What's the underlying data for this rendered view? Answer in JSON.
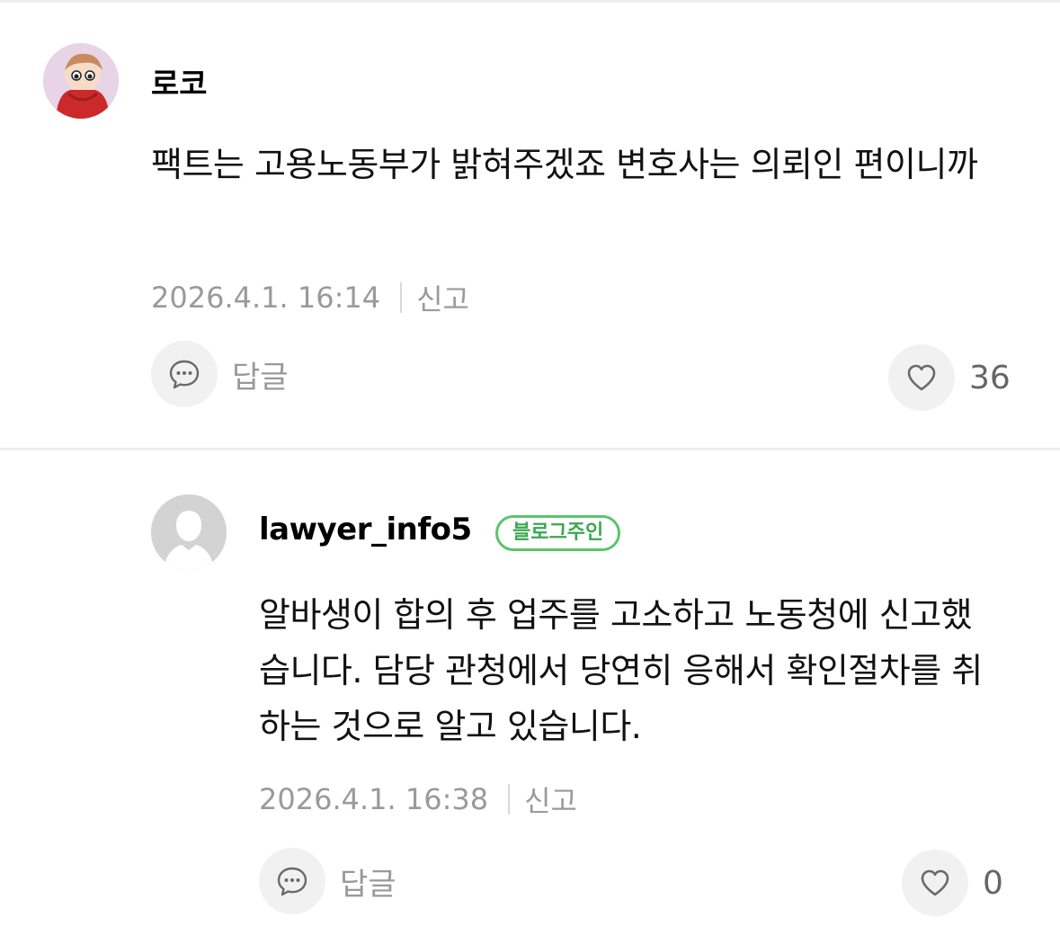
{
  "comments": [
    {
      "author": "로코",
      "badge": "",
      "text": "팩트는 고용노동부가 밝혀주겠죠 변호사는 의뢰인 편이니까",
      "timestamp": "2026.4.1. 16:14",
      "report_label": "신고",
      "reply_label": "답글",
      "like_count": "36",
      "avatar_icon": "cartoon-avatar"
    },
    {
      "author": "lawyer_info5",
      "badge": "블로그주인",
      "text": "알바생이 합의 후 업주를 고소하고 노동청에 신고했습니다. 담당 관청에서 당연히 응해서 확인절차를 취하는 것으로 알고 있습니다.",
      "timestamp": "2026.4.1. 16:38",
      "report_label": "신고",
      "reply_label": "답글",
      "like_count": "0",
      "avatar_icon": "default-user-avatar"
    }
  ],
  "colors": {
    "badge_green": "#3aa850",
    "meta_gray": "#9a9a9a",
    "button_bg": "#f1f1f1"
  }
}
